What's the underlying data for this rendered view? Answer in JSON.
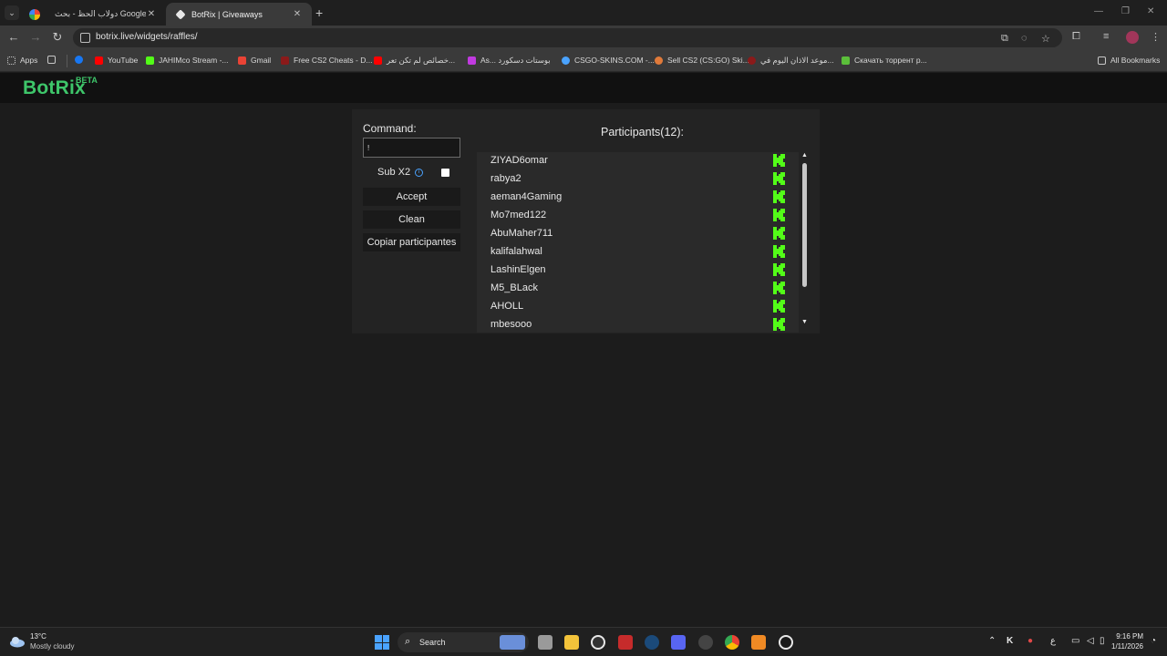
{
  "browser": {
    "tabs": [
      {
        "title": "دولاب الحظ - بحث Google",
        "icon": "google-icon"
      },
      {
        "title": "BotRix | Giveaways",
        "icon": "botrix-icon"
      }
    ],
    "url": "botrix.live/widgets/raffles/",
    "bookmarks": [
      {
        "label": "Apps",
        "color": "#c7c7c7"
      },
      {
        "label": "",
        "color": "#c7c7c7"
      },
      {
        "label": "YouTube",
        "color": "#ff0000"
      },
      {
        "label": "JAHIMco Stream -...",
        "color": "#53fc18"
      },
      {
        "label": "Gmail",
        "color": "#ea4335"
      },
      {
        "label": "Free CS2 Cheats - D...",
        "color": "#8b1a1a"
      },
      {
        "label": "خصائص لم تكن تعر...",
        "color": "#ff0000"
      },
      {
        "label": "As... بوستات دسكورد",
        "color": "#c13ae0"
      },
      {
        "label": "CSGO-SKINS.COM -...",
        "color": "#4aa3ff"
      },
      {
        "label": "Sell CS2 (CS:GO) Ski...",
        "color": "#e07a3a"
      },
      {
        "label": "موعد الاذان اليوم في...",
        "color": "#8b1a1a"
      },
      {
        "label": "Скачать торрент р...",
        "color": "#5bbf3a"
      }
    ],
    "all_bookmarks": "All Bookmarks"
  },
  "app": {
    "logo": "BotRix",
    "beta": "BETA",
    "command_label": "Command:",
    "command_value": "!",
    "sub_x2_label": "Sub X2",
    "sub_x2_checked": false,
    "accept_label": "Accept",
    "clean_label": "Clean",
    "copy_label": "Copiar participantes",
    "participants_title": "Participants(12):",
    "participants": [
      "ZIYAD6omar",
      "rabya2",
      "aeman4Gaming",
      "Mo7med122",
      "AbuMaher711",
      "kalifalahwal",
      "LashinElgen",
      "M5_BLack",
      "AHOLL",
      "mbesooo"
    ],
    "accent_color": "#3ec66a",
    "kick_color": "#53fc18"
  },
  "taskbar": {
    "temperature": "13°C",
    "weather": "Mostly cloudy",
    "search_label": "Search",
    "time": "9:16 PM",
    "date": "1/11/2026",
    "input_lang": "ع"
  }
}
